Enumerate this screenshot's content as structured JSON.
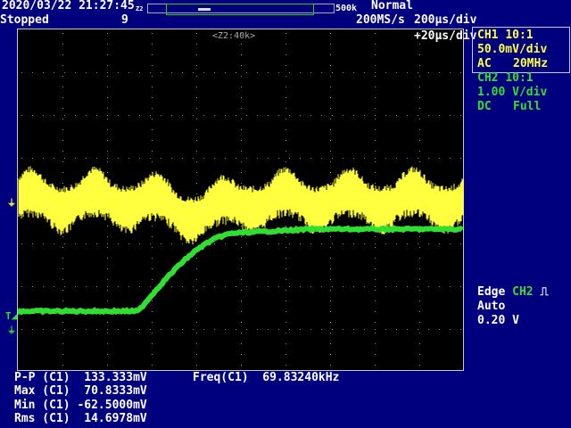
{
  "header": {
    "datetime": "2020/03/22 21:27:45",
    "zoom_tag": "Z2",
    "memory_length": "500k",
    "trigger_mode": "Normal",
    "status": "Stopped",
    "acq_count": "9",
    "sample_rate": "200MS/s",
    "timebase": "200µs/div",
    "zoom_label": "<Z2:40k>",
    "zoom_timebase": "+20µs/div"
  },
  "ch1": {
    "name": "CH1",
    "probe": "10:1",
    "scale": "50.0mV/div",
    "coupling": "AC",
    "bandwidth": "20MHz",
    "color": "#ffff40"
  },
  "ch2": {
    "name": "CH2",
    "probe": "10:1",
    "scale": "1.00 V/div",
    "coupling": "DC",
    "bandwidth": "Full",
    "color": "#30e030"
  },
  "trigger": {
    "type": "Edge",
    "source": "CH2",
    "mode": "Auto",
    "level": "0.20 V"
  },
  "measurements": [
    {
      "label": "P-P (C1)",
      "value": "133.333mV"
    },
    {
      "label": "Max (C1)",
      "value": "70.8333mV"
    },
    {
      "label": "Min (C1)",
      "value": "-62.5000mV"
    },
    {
      "label": "Rms (C1)",
      "value": "14.6978mV"
    },
    {
      "label": "Freq(C1)",
      "value": "69.83240kHz"
    }
  ]
}
